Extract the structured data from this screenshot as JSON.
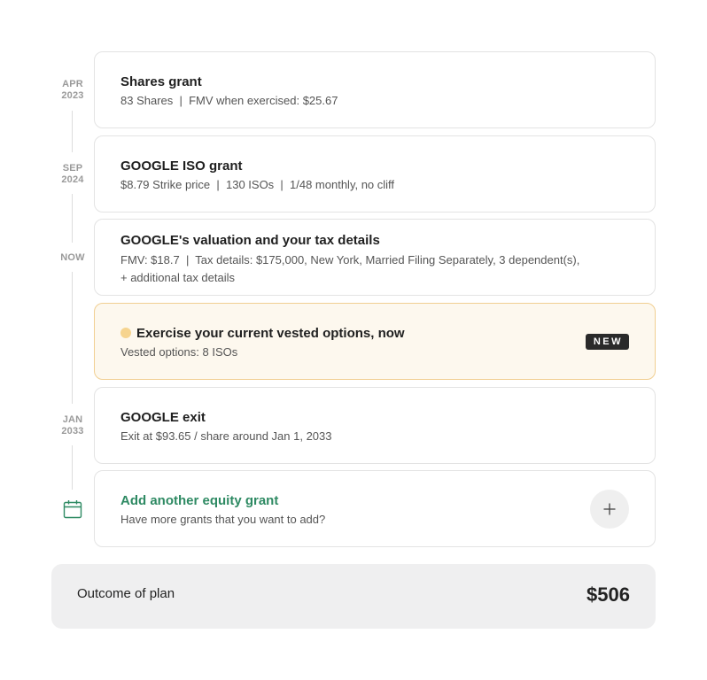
{
  "timeline": {
    "events": [
      {
        "date_month": "APR",
        "date_year": "2023",
        "title": "Shares grant",
        "subtitle": "83 Shares  |  FMV when exercised: $25.67"
      },
      {
        "date_month": "SEP",
        "date_year": "2024",
        "title": "GOOGLE ISO grant",
        "subtitle": "$8.79 Strike price  |  130 ISOs  |  1/48 monthly, no cliff"
      },
      {
        "date_month": "NOW",
        "date_year": "",
        "title": "GOOGLE's valuation and your tax details",
        "subtitle_line1": "FMV: $18.7  |  Tax details: $175,000, New York, Married Filing Separately, 3 dependent(s),",
        "subtitle_line2": "+ additional tax details"
      },
      {
        "title": "Exercise your current vested options, now",
        "subtitle": "Vested options: 8 ISOs",
        "badge": "NEW"
      },
      {
        "date_month": "JAN",
        "date_year": "2033",
        "title": "GOOGLE exit",
        "subtitle": "Exit at $93.65 / share around Jan 1, 2033"
      }
    ],
    "add_grant": {
      "title": "Add another equity grant",
      "subtitle": "Have more grants that you want to add?",
      "icon": "plus-icon"
    }
  },
  "outcome": {
    "label": "Outcome of plan",
    "value": "$506"
  },
  "colors": {
    "accent_green": "#2e8a63",
    "highlight_bg": "#fdf8ee",
    "highlight_border": "#f1cf92",
    "dot": "#f6d48f"
  }
}
